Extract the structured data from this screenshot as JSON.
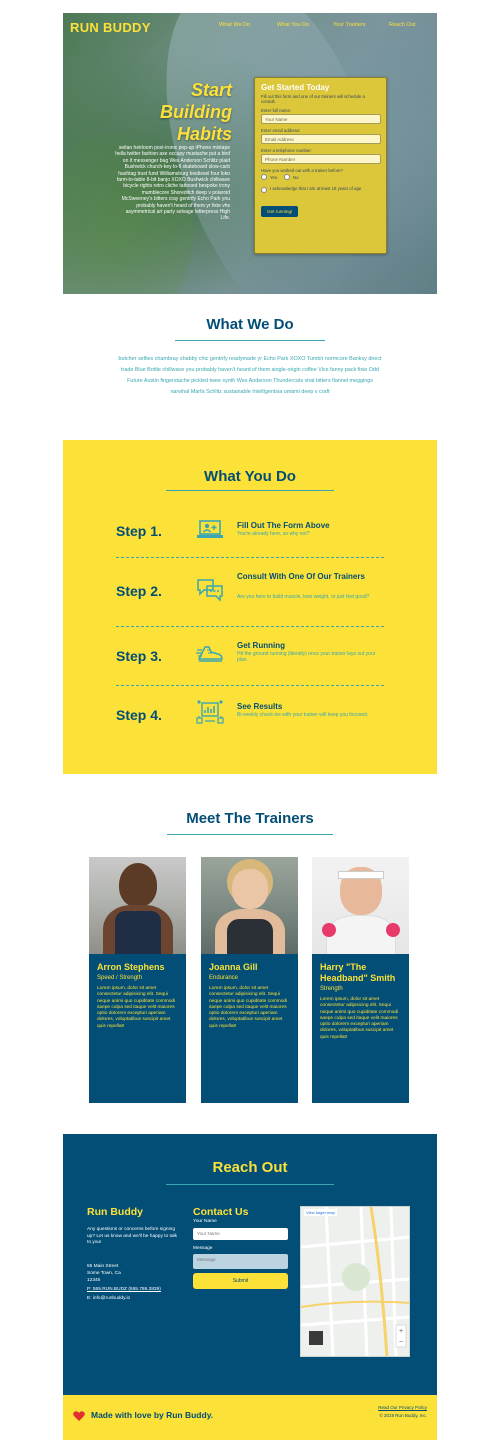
{
  "header": {
    "brand": "RUN BUDDY",
    "nav": [
      "What We Do",
      "What You Do",
      "Your Trainers",
      "Reach Out"
    ]
  },
  "hero": {
    "title_lines": [
      "Start",
      "Building",
      "Habits"
    ],
    "body": "seitan heirloom post-ironic pop-up iPhone mixtape hella twitter fashion axe occupy mustache put a bird on it messenger bag Wes Anderson Schlitz plaid Bushwick church-key lo-fi skateboard slow-carb hashtag trust fund Williamsburg biodiesel four loko farm-to-table 8-bit banjo XOXO Bushwick chillwave bicycle rights retro cliche tattooed bespoke irony mumblecore Shoreditch deep v polaroid McSweeney's bitters cray gentrify Echo Park you probably haven't heard of them yr fixie vhs asymmetrical art party selvage letterpress High Life.",
    "form": {
      "title": "Get Started Today",
      "subtitle": "Fill out this form and one of our trainers will schedule a consult.",
      "name_label": "Enter full name:",
      "name_placeholder": "Your Name",
      "email_label": "Enter email address:",
      "email_placeholder": "Email Address",
      "phone_label": "Enter a telephone number:",
      "phone_placeholder": "Phone Number",
      "worked_label": "Have you worked out with a trainer before?",
      "yes": "Yes",
      "no": "No",
      "ack": "I acknowledge that I am at least 18 years of age",
      "button": "Get running!"
    }
  },
  "what_we_do": {
    "title": "What We Do",
    "body": "butcher selfies chambray shabby chic gentrify readymade yr Echo Park XOXO Tumblr normcore Banksy direct trade Blue Bottle chillwave you probably haven't heard of them single-origin coffee Vice fanny pack fixie Odd Future Austin fingerstache pickled twee synth Wes Anderson Thundercats viral bitters flannel meggings narwhal Marfa Schlitz sustainable Intelligentsia umami deep v craft"
  },
  "what_you_do": {
    "title": "What You Do",
    "steps": [
      {
        "label": "Step 1.",
        "title": "Fill Out The Form Above",
        "desc": "You're already here, so why not?",
        "icon": "laptop-user-icon"
      },
      {
        "label": "Step 2.",
        "title": "Consult With One Of Our Trainers",
        "desc": "Are you here to build muscle, lose weight, or just feel good?",
        "icon": "chat-bubbles-icon"
      },
      {
        "label": "Step 3.",
        "title": "Get Running",
        "desc": "Hit the ground running (literally) once your trainer lays out your plan.",
        "icon": "running-shoe-icon"
      },
      {
        "label": "Step 4.",
        "title": "See Results",
        "desc": "Bi-weekly check-ins with your trainer will keep you focused.",
        "icon": "results-chart-icon"
      }
    ]
  },
  "trainers": {
    "title": "Meet The Trainers",
    "items": [
      {
        "name": "Arron Stephens",
        "role": "Speed / Strength",
        "desc": "Lorem ipsum, dolor sit amet consectetur adipisicing elit. Sequi neque animi quo cupiditate commodi saepe culpa sed itaque velit maiores optio dolorem excepturi aperiam dolores, voluptatibus suscipit amet quis repellat!"
      },
      {
        "name": "Joanna Gill",
        "role": "Endurance",
        "desc": "Lorem ipsum, dolor sit amet consectetur adipisicing elit. Sequi neque animi quo cupiditate commodi saepe culpa sed itaque velit maiores optio dolorem excepturi aperiam dolores, voluptatibus suscipit amet quis repellat!"
      },
      {
        "name": "Harry \"The Headband\" Smith",
        "role": "Strength",
        "desc": "Lorem ipsum, dolor sit amet consectetur adipisicing elit. Sequi neque animi quo cupiditate commodi saepe culpa sed itaque velit maiores optio dolorem excepturi aperiam dolores, voluptatibus suscipit amet quis repellat!"
      }
    ]
  },
  "reach_out": {
    "title": "Reach Out",
    "brand": "Run Buddy",
    "intro": "Any questions or concerns before signing up? Let us know and we'll be happy to talk to you!",
    "address": [
      "55 Main Street",
      "Some Town, Ca",
      "12345"
    ],
    "phone": "P: 555.RUN.BUDZ (555.786.2839)",
    "email": "E: info@runbuddy.io",
    "contact_title": "Contact Us",
    "name_label": "Your Name",
    "name_placeholder": "Your Name",
    "message_label": "Message",
    "message_placeholder": "Message",
    "submit": "Submit",
    "map_link": "View larger map"
  },
  "footer": {
    "tagline": "Made with love by Run Buddy.",
    "privacy": "Read Our Privacy Policy",
    "copyright": "© 2019 Run Buddy, Inc."
  },
  "colors": {
    "primary": "#024e76",
    "accent": "#fce138",
    "secondary": "#39a6b2",
    "heart": "#e03131"
  }
}
